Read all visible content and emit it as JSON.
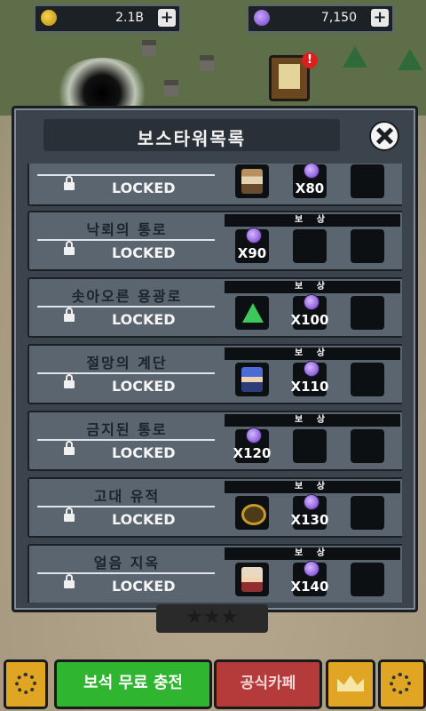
{
  "resources": {
    "gold": {
      "value": "2.1B",
      "icon": "gold-coin-icon"
    },
    "gems": {
      "value": "7,150",
      "icon": "purple-gem-icon"
    }
  },
  "modal": {
    "title": "보스타워목록",
    "reward_header": "보 상",
    "rows": [
      {
        "name": "",
        "status": "LOCKED",
        "rewards": [
          {
            "type": "character",
            "icon": "warrior-character-icon"
          },
          {
            "type": "gem",
            "qty": "X80"
          },
          {
            "type": "empty"
          }
        ]
      },
      {
        "name": "낙뢰의 통로",
        "status": "LOCKED",
        "rewards": [
          {
            "type": "gem",
            "qty": "X90"
          },
          {
            "type": "empty"
          },
          {
            "type": "empty"
          }
        ]
      },
      {
        "name": "솟아오른 용광로",
        "status": "LOCKED",
        "rewards": [
          {
            "type": "item",
            "icon": "green-triangle-relic-icon"
          },
          {
            "type": "gem",
            "qty": "X100"
          },
          {
            "type": "empty"
          }
        ]
      },
      {
        "name": "절망의 계단",
        "status": "LOCKED",
        "rewards": [
          {
            "type": "character",
            "icon": "blue-hair-character-icon"
          },
          {
            "type": "gem",
            "qty": "X110"
          },
          {
            "type": "empty"
          }
        ]
      },
      {
        "name": "금지된 통로",
        "status": "LOCKED",
        "rewards": [
          {
            "type": "gem",
            "qty": "X120"
          },
          {
            "type": "empty"
          },
          {
            "type": "empty"
          }
        ]
      },
      {
        "name": "고대 유적",
        "status": "LOCKED",
        "rewards": [
          {
            "type": "item",
            "icon": "gold-ring-icon"
          },
          {
            "type": "gem",
            "qty": "X130"
          },
          {
            "type": "empty"
          }
        ]
      },
      {
        "name": "얼음 지옥",
        "status": "LOCKED",
        "rewards": [
          {
            "type": "character",
            "icon": "white-hair-character-icon"
          },
          {
            "type": "gem",
            "qty": "X140"
          },
          {
            "type": "empty"
          }
        ]
      }
    ]
  },
  "bottom": {
    "free_gem_label": "보석 무료 충전",
    "cafe_label": "공식카페"
  },
  "colors": {
    "panel": "#3b444d",
    "row": "#5a6570",
    "gem_button": "#2fb52f",
    "cafe_button": "#b53a3a",
    "gold_button": "#e0a623"
  }
}
